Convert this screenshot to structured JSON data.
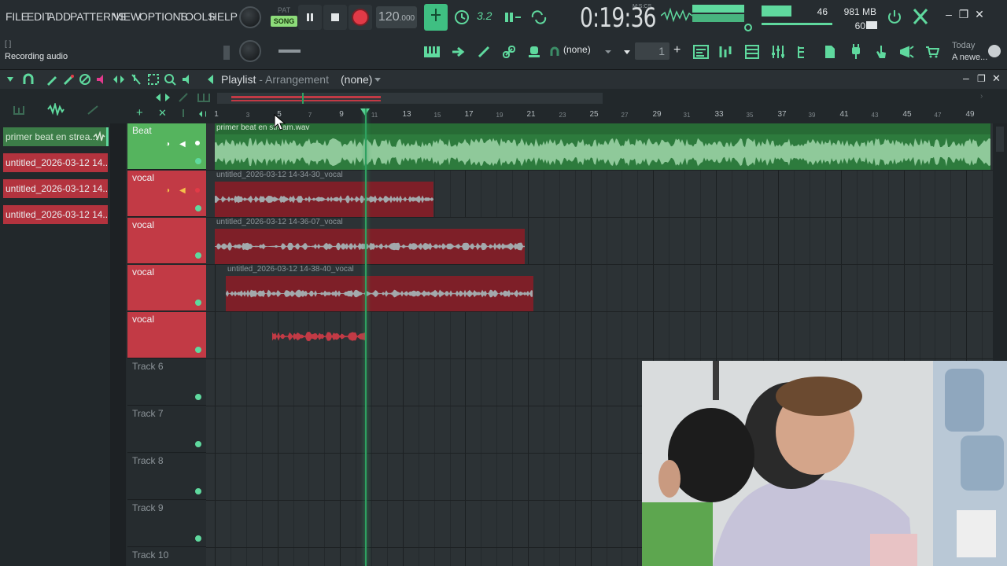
{
  "menu": [
    "FILE",
    "EDIT",
    "ADD",
    "PATTERNS",
    "VIEW",
    "OPTIONS",
    "TOOLS",
    "HELP"
  ],
  "hint": {
    "brackets": "[  ]",
    "message": "Recording audio"
  },
  "transport": {
    "pat": "PAT",
    "song": "SONG",
    "tempo_main": "120",
    "tempo_frac": ".000"
  },
  "time": {
    "display": "0:19:36",
    "unit": "M:S:CS"
  },
  "stats": {
    "cpu": "46",
    "memory": "981 MB",
    "polyphony": "60"
  },
  "toolbar": {
    "pattern_select": "(none)",
    "pattern_number": "1"
  },
  "news": {
    "date": "Today",
    "text": "A newe..."
  },
  "playlist": {
    "title": "Playlist",
    "subtitle": " - Arrangement",
    "selection": "(none)"
  },
  "picker": {
    "items": [
      {
        "label": "primer beat en strea...",
        "type": "audio"
      },
      {
        "label": "untitled_2026-03-12 14...",
        "type": "vocal"
      },
      {
        "label": "untitled_2026-03-12 14...",
        "type": "vocal"
      },
      {
        "label": "untitled_2026-03-12 14...",
        "type": "vocal"
      }
    ]
  },
  "tracks": [
    {
      "name": "Beat",
      "type": "beat"
    },
    {
      "name": "vocal",
      "type": "vocal"
    },
    {
      "name": "vocal",
      "type": "vocal"
    },
    {
      "name": "vocal",
      "type": "vocal"
    },
    {
      "name": "vocal",
      "type": "vocal"
    },
    {
      "name": "Track 6",
      "type": "empty"
    },
    {
      "name": "Track 7",
      "type": "empty"
    },
    {
      "name": "Track 8",
      "type": "empty"
    },
    {
      "name": "Track 9",
      "type": "empty"
    },
    {
      "name": "Track 10",
      "type": "empty"
    }
  ],
  "ruler": {
    "major": [
      "1",
      "5",
      "9",
      "13",
      "17",
      "21",
      "25",
      "29",
      "33",
      "37",
      "41",
      "45",
      "49"
    ],
    "minor": [
      "3",
      "7",
      "11",
      "15",
      "19",
      "23",
      "27",
      "31",
      "35",
      "39",
      "43",
      "47"
    ]
  },
  "clips": [
    {
      "label": "primer beat en stream.wav",
      "color": "green"
    },
    {
      "label": "untitled_2026-03-12 14-34-30_vocal",
      "color": "red"
    },
    {
      "label": "untitled_2026-03-12 14-36-07_vocal",
      "color": "red"
    },
    {
      "label": "untitled_2026-03-12 14-38-40_vocal",
      "color": "red"
    },
    {
      "label": "",
      "color": "red"
    }
  ],
  "colors": {
    "accent": "#5fd99e",
    "beat_track": "#55b45e",
    "vocal_track": "#c23a45",
    "playhead": "#2ea160",
    "record": "#e23a47"
  }
}
